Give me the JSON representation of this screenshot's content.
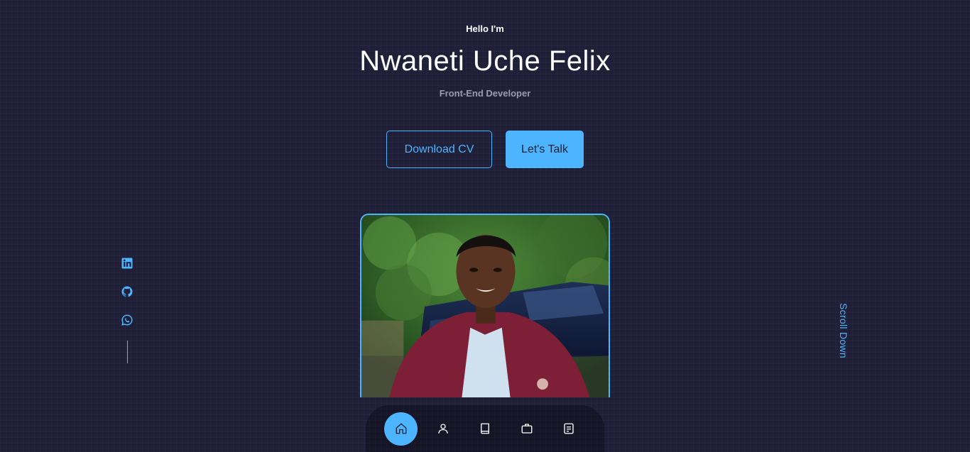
{
  "header": {
    "greeting": "Hello I'm",
    "name": "Nwaneti Uche Felix",
    "role": "Front-End Developer"
  },
  "cta": {
    "download_cv_label": "Download CV",
    "lets_talk_label": "Let's Talk"
  },
  "socials": {
    "items": [
      {
        "icon": "linkedin-icon"
      },
      {
        "icon": "github-icon"
      },
      {
        "icon": "whatsapp-icon"
      }
    ]
  },
  "profile_photo": {
    "subject": "portrait-photo"
  },
  "scroll": {
    "label": "Scroll Down"
  },
  "nav": {
    "items": [
      {
        "icon": "home-icon",
        "active": true
      },
      {
        "icon": "user-icon",
        "active": false
      },
      {
        "icon": "book-icon",
        "active": false
      },
      {
        "icon": "briefcase-icon",
        "active": false
      },
      {
        "icon": "message-icon",
        "active": false
      }
    ]
  },
  "colors": {
    "background": "#1f1f38",
    "accent": "#4db5ff",
    "text": "#ffffff",
    "muted": "#9a9ab0"
  }
}
